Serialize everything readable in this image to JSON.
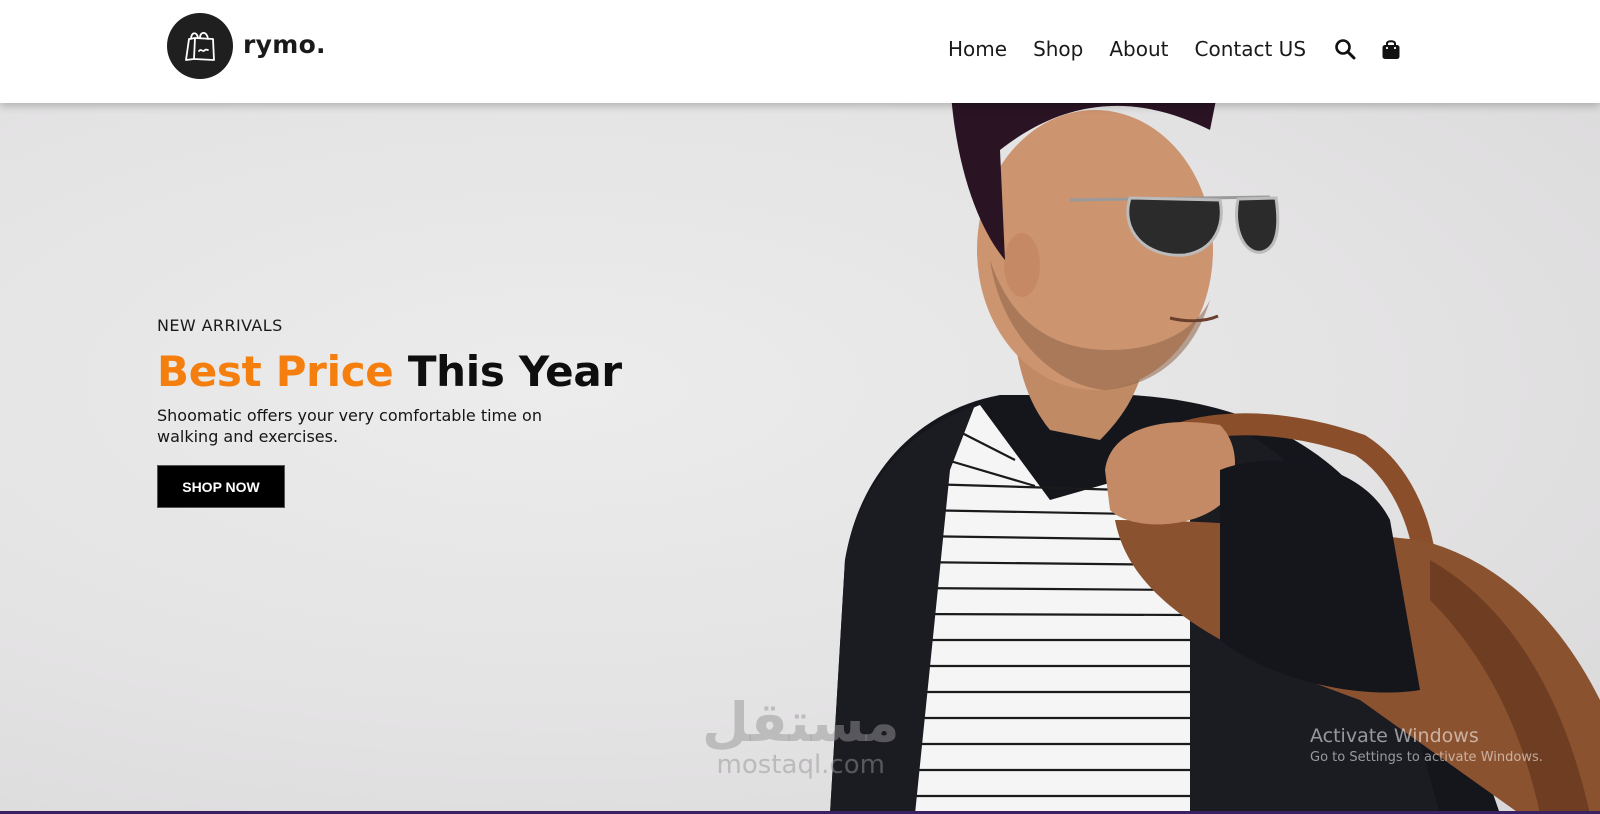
{
  "brand": {
    "name": "rymo.",
    "logo_icon": "shopping-bag-icon"
  },
  "nav": {
    "items": [
      {
        "label": "Home"
      },
      {
        "label": "Shop"
      },
      {
        "label": "About"
      },
      {
        "label": "Contact US"
      }
    ],
    "search_icon": "search-icon",
    "cart_icon": "cart-bag-icon"
  },
  "hero": {
    "eyebrow": "NEW ARRIVALS",
    "headline_accent": "Best Price",
    "headline_rest": "This Year",
    "subtitle": "Shoomatic offers your very comfortable time on walking and exercises.",
    "cta_label": "SHOP NOW",
    "image": "man-with-beanie-sunglasses-leather-bag"
  },
  "watermarks": {
    "site_arabic": "مستقل",
    "site_latin": "mostaql.com",
    "windows_title": "Activate Windows",
    "windows_subtitle": "Go to Settings to activate Windows."
  },
  "colors": {
    "accent": "#f57f0e",
    "text_dark": "#0e0e0e",
    "button_bg": "#000000",
    "bottom_bar": "#3b2062"
  }
}
